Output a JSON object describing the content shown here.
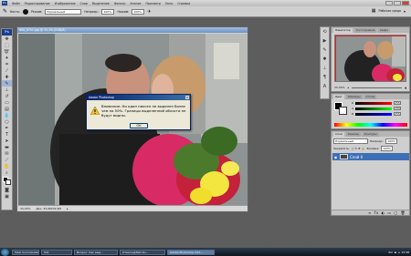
{
  "window": {
    "title": "Adobe Photoshop CS3 Extended",
    "menus": [
      "Файл",
      "Редактирование",
      "Изображение",
      "Слои",
      "Выделение",
      "Фильтр",
      "Анализ",
      "Просмотр",
      "Окно",
      "Справка"
    ]
  },
  "options_bar": {
    "brush_label": "Кисть:",
    "mode_label": "Режим:",
    "mode_value": "Нормальный",
    "opacity_label": "Непрозр.:",
    "opacity_value": "100%",
    "flow_label": "Нажим:",
    "flow_value": "100%",
    "workspace_label": "Рабочая среда"
  },
  "document": {
    "title": "IMG_0701.jpg @ 33,3% (RGB/8)",
    "zoom": "33,33%",
    "status": "Док: 32,9M/32,9M"
  },
  "alert": {
    "title": "Adobe Photoshop",
    "message": "Внимание: Ни один пиксел не выделен более чем на 50%. Границы выделенной области не будут видны.",
    "ok_label": "OK"
  },
  "navigator_panel": {
    "tabs": [
      "Навигатор",
      "Гистограмма",
      "Инфо"
    ],
    "zoom": "33,33%"
  },
  "color_panel": {
    "tabs": [
      "Цвет",
      "Образцы",
      "Стили"
    ],
    "channels": [
      {
        "name": "R",
        "value": "255",
        "color": "#ff0000"
      },
      {
        "name": "G",
        "value": "255",
        "color": "#00ff00"
      },
      {
        "name": "B",
        "value": "255",
        "color": "#0000ff"
      }
    ]
  },
  "layers_panel": {
    "tabs": [
      "Слои",
      "Каналы",
      "Контуры"
    ],
    "blend_mode": "Нормальный",
    "opacity_label": "Непрозр.:",
    "opacity_value": "100%",
    "lock_label": "Закрепить:",
    "fill_label": "Заливка:",
    "fill_value": "100%",
    "layer_name": "Слой 0"
  },
  "taskbar": {
    "items": [
      {
        "label": "Total Commander",
        "active": false
      },
      {
        "label": "ICQ",
        "active": false
      },
      {
        "label": "Вопрос: Как выд...",
        "active": false
      },
      {
        "label": "Ответы@Mail.Ru...",
        "active": false
      },
      {
        "label": "Adobe Photoshop CS3...",
        "active": true
      }
    ],
    "lang": "RU",
    "clock": "15:48"
  },
  "colors": {
    "accent": "#3d6fb6",
    "alert_title": "#0a246a"
  }
}
